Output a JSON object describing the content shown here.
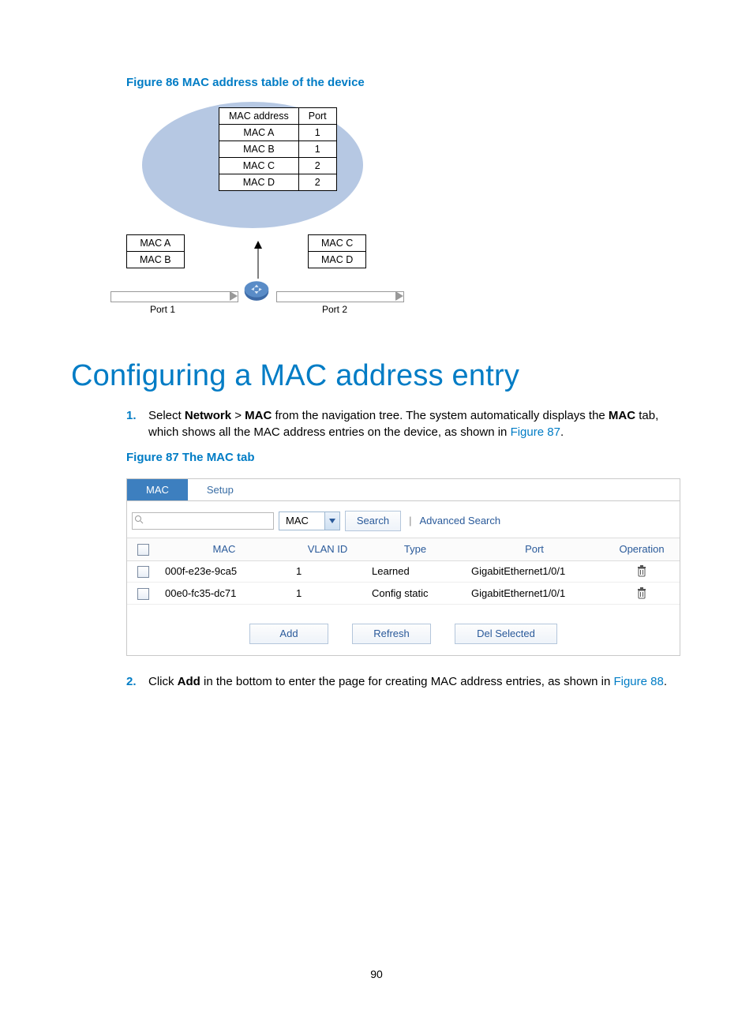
{
  "figure86": {
    "caption": "Figure 86 MAC address table of the device",
    "table": {
      "headers": [
        "MAC address",
        "Port"
      ],
      "rows": [
        [
          "MAC A",
          "1"
        ],
        [
          "MAC B",
          "1"
        ],
        [
          "MAC C",
          "2"
        ],
        [
          "MAC D",
          "2"
        ]
      ]
    },
    "left_box": [
      "MAC A",
      "MAC B"
    ],
    "right_box": [
      "MAC C",
      "MAC D"
    ],
    "port1_label": "Port 1",
    "port2_label": "Port 2"
  },
  "heading": "Configuring a MAC address entry",
  "step1": {
    "num": "1.",
    "pre": "Select ",
    "b1": "Network",
    "gt": " > ",
    "b2": "MAC",
    "mid": " from the navigation tree. The system automatically displays the ",
    "b3": "MAC",
    "post": " tab, which shows all the MAC address entries on the device, as shown in ",
    "link": "Figure 87",
    "end": "."
  },
  "figure87": {
    "caption": "Figure 87 The MAC tab",
    "tabs": {
      "active": "MAC",
      "other": "Setup"
    },
    "select_value": "MAC",
    "search_btn": "Search",
    "advanced": "Advanced Search",
    "columns": [
      "MAC",
      "VLAN ID",
      "Type",
      "Port",
      "Operation"
    ],
    "rows": [
      {
        "mac": "000f-e23e-9ca5",
        "vlan": "1",
        "type": "Learned",
        "port": "GigabitEthernet1/0/1"
      },
      {
        "mac": "00e0-fc35-dc71",
        "vlan": "1",
        "type": "Config static",
        "port": "GigabitEthernet1/0/1"
      }
    ],
    "buttons": {
      "add": "Add",
      "refresh": "Refresh",
      "del": "Del Selected"
    }
  },
  "step2": {
    "num": "2.",
    "pre": "Click ",
    "b1": "Add",
    "mid": " in the bottom to enter the page for creating MAC address entries, as shown in ",
    "link": "Figure 88",
    "end": "."
  },
  "page_number": "90"
}
